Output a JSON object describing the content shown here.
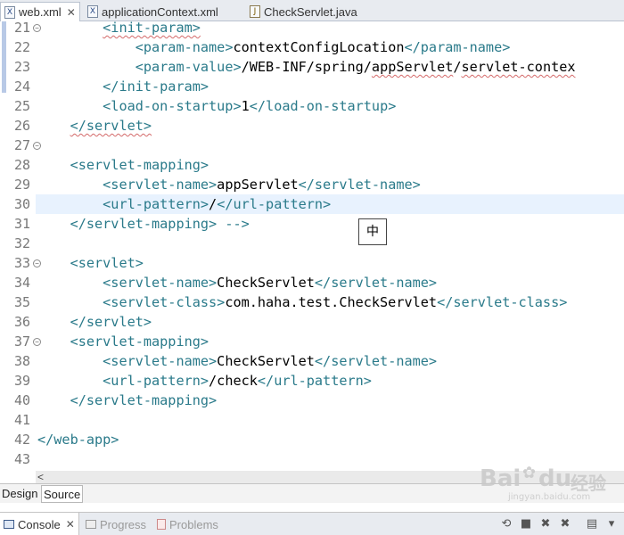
{
  "editor_tabs": [
    {
      "label": "web.xml",
      "close": "✕",
      "active": true
    },
    {
      "label": "applicationContext.xml",
      "active": false
    },
    {
      "label": "CheckServlet.java",
      "active": false
    }
  ],
  "lines": [
    {
      "num": "21",
      "fold": "−"
    },
    {
      "num": "22"
    },
    {
      "num": "23"
    },
    {
      "num": "24"
    },
    {
      "num": "25"
    },
    {
      "num": "26"
    },
    {
      "num": "27",
      "fold": "−"
    },
    {
      "num": "28"
    },
    {
      "num": "29"
    },
    {
      "num": "30",
      "current": true
    },
    {
      "num": "31"
    },
    {
      "num": "32"
    },
    {
      "num": "33",
      "fold": "−"
    },
    {
      "num": "34"
    },
    {
      "num": "35"
    },
    {
      "num": "36"
    },
    {
      "num": "37",
      "fold": "−"
    },
    {
      "num": "38"
    },
    {
      "num": "39"
    },
    {
      "num": "40"
    },
    {
      "num": "41"
    },
    {
      "num": "42"
    },
    {
      "num": "43"
    }
  ],
  "code": {
    "l21": "<init-param>",
    "l22_open": "<param-name>",
    "l22_text": "contextConfigLocation",
    "l22_close": "</param-name>",
    "l23_open": "<param-value>",
    "l23_text_a": "/WEB-INF/spring/",
    "l23_text_b": "appServlet",
    "l23_text_c": "/",
    "l23_text_d": "servlet-contex",
    "l24": "</init-param>",
    "l25_open": "<load-on-startup>",
    "l25_text": "1",
    "l25_close": "</load-on-startup>",
    "l26": "</servlet>",
    "l28": "<servlet-mapping>",
    "l29_open": "<servlet-name>",
    "l29_text": "appServlet",
    "l29_close": "</servlet-name>",
    "l30_open": "<url-pattern>",
    "l30_text": "/",
    "l30_close": "</url-pattern>",
    "l31_tag": "</servlet-mapping>",
    "l31_comment": " -->",
    "l33": "<servlet>",
    "l34_open": "<servlet-name>",
    "l34_text": "CheckServlet",
    "l34_close": "</servlet-name>",
    "l35_open": "<servlet-class>",
    "l35_text": "com.haha.test.CheckServlet",
    "l35_close": "</servlet-class>",
    "l36": "</servlet>",
    "l37": "<servlet-mapping>",
    "l38_open": "<servlet-name>",
    "l38_text": "CheckServlet",
    "l38_close": "</servlet-name>",
    "l39_open": "<url-pattern>",
    "l39_text": "/check",
    "l39_close": "</url-pattern>",
    "l40": "</servlet-mapping>",
    "l42": "</web-app>"
  },
  "ime_indicator": "中",
  "scroll_left": "<",
  "bottom_tabs": {
    "design": "Design",
    "source": "Source"
  },
  "console": {
    "console_label": "Console",
    "console_close": "✕",
    "progress_label": "Progress",
    "problems_label": "Problems"
  },
  "watermark": {
    "brand": "Bai",
    "paw": "du",
    "suffix": "经验",
    "url": "jingyan.baidu.com"
  },
  "colors": {
    "tag": "#2a7a8a",
    "comment": "#3f5fbf",
    "current_line": "#e8f2fe",
    "line_number": "#787878"
  }
}
